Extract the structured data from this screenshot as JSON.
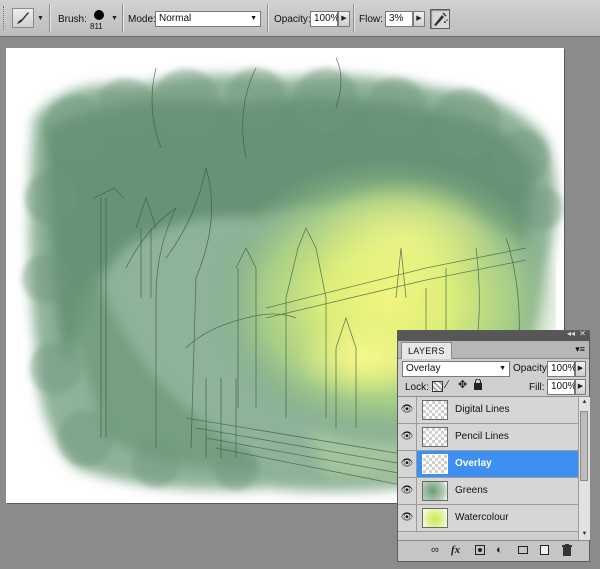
{
  "options_bar": {
    "brush_label": "Brush:",
    "brush_size": "811",
    "mode_label": "Mode:",
    "mode_value": "Normal",
    "opacity_label": "Opacity:",
    "opacity_value": "100%",
    "flow_label": "Flow:",
    "flow_value": "3%"
  },
  "layers_panel": {
    "tab_label": "LAYERS",
    "blend_mode": "Overlay",
    "opacity_label": "Opacity:",
    "opacity_value": "100%",
    "lock_label": "Lock:",
    "fill_label": "Fill:",
    "fill_value": "100%",
    "layers": [
      {
        "name": "Digital Lines",
        "selected": false,
        "visible": true
      },
      {
        "name": "Pencil Lines",
        "selected": false,
        "visible": true
      },
      {
        "name": "Overlay",
        "selected": true,
        "visible": true
      },
      {
        "name": "Greens",
        "selected": false,
        "visible": true
      },
      {
        "name": "Watercolour",
        "selected": false,
        "visible": true
      }
    ]
  },
  "icons": [
    "brush-tool-icon",
    "brush-tip-icon",
    "airbrush-icon",
    "eye-icon",
    "link-icon",
    "fx-icon",
    "mask-icon",
    "adjustment-icon",
    "folder-icon",
    "new-layer-icon",
    "trash-icon"
  ],
  "colors": {
    "selected_layer": "#3d8ff0",
    "canvas_green": "#5d8a6a",
    "canvas_yellow": "#e6f27a"
  }
}
